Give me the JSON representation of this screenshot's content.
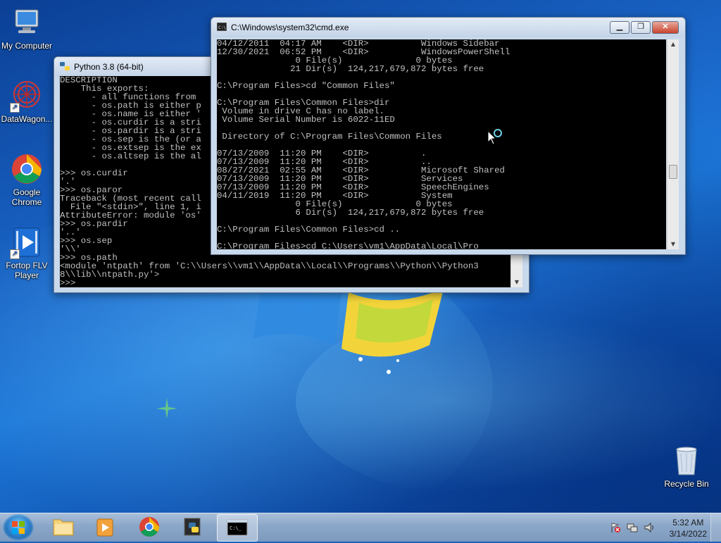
{
  "desktop_icons": [
    {
      "label": "My Computer",
      "icon": "computer-icon"
    },
    {
      "label": "DataWagon...",
      "icon": "datawagon-icon"
    },
    {
      "label": "Google Chrome",
      "icon": "chrome-icon"
    },
    {
      "label": "Fortop FLV Player",
      "icon": "flv-player-icon"
    },
    {
      "label": "Recycle Bin",
      "icon": "recycle-bin-icon"
    }
  ],
  "python_window": {
    "title": "Python 3.8 (64-bit)",
    "lines": [
      "DESCRIPTION",
      "    This exports:",
      "      - all functions from",
      "      - os.path is either p",
      "      - os.name is either '",
      "      - os.curdir is a stri",
      "      - os.pardir is a stri",
      "      - os.sep is the (or a",
      "      - os.extsep is the ex",
      "      - os.altsep is the al",
      "",
      ">>> os.curdir",
      "'.'",
      ">>> os.paror",
      "Traceback (most recent call",
      "  File \"<stdin>\", line 1, i",
      "AttributeError: module 'os'",
      ">>> os.pardir",
      "'..'",
      ">>> os.sep",
      "'\\\\'",
      ">>> os.path",
      "<module 'ntpath' from 'C:\\\\Users\\\\vm1\\\\AppData\\\\Local\\\\Programs\\\\Python\\\\Python3",
      "8\\\\lib\\\\ntpath.py'>",
      ">>>"
    ]
  },
  "cmd_window": {
    "title": "C:\\Windows\\system32\\cmd.exe",
    "lines": [
      "04/12/2011  04:17 AM    <DIR>          Windows Sidebar",
      "12/30/2021  06:52 PM    <DIR>          WindowsPowerShell",
      "               0 File(s)              0 bytes",
      "              21 Dir(s)  124,217,679,872 bytes free",
      "",
      "C:\\Program Files>cd \"Common Files\"",
      "",
      "C:\\Program Files\\Common Files>dir",
      " Volume in drive C has no label.",
      " Volume Serial Number is 6022-11ED",
      "",
      " Directory of C:\\Program Files\\Common Files",
      "",
      "07/13/2009  11:20 PM    <DIR>          .",
      "07/13/2009  11:20 PM    <DIR>          ..",
      "08/27/2021  02:55 AM    <DIR>          Microsoft Shared",
      "07/13/2009  11:20 PM    <DIR>          Services",
      "07/13/2009  11:20 PM    <DIR>          SpeechEngines",
      "04/11/2019  11:20 PM    <DIR>          System",
      "               0 File(s)              0 bytes",
      "               6 Dir(s)  124,217,679,872 bytes free",
      "",
      "C:\\Program Files\\Common Files>cd ..",
      "",
      "C:\\Program Files>cd C:\\Users\\vm1\\AppData\\Local\\Pro"
    ]
  },
  "taskbar": {
    "items": [
      {
        "name": "explorer",
        "icon": "folder-icon"
      },
      {
        "name": "media-player",
        "icon": "media-player-icon"
      },
      {
        "name": "chrome",
        "icon": "chrome-icon"
      },
      {
        "name": "python",
        "icon": "python-icon"
      },
      {
        "name": "cmd",
        "icon": "cmd-icon",
        "active": true
      }
    ],
    "time": "5:32 AM",
    "date": "3/14/2022"
  },
  "colors": {
    "console_bg": "#000000",
    "console_fg": "#c0c0c0",
    "desktop_blue": "#1a67c9"
  }
}
